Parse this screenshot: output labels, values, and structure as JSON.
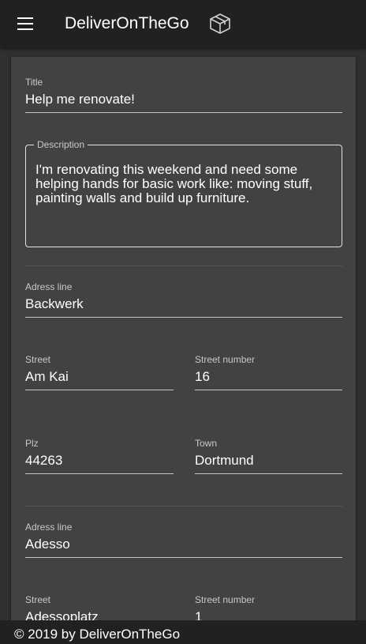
{
  "app": {
    "title": "DeliverOnTheGo",
    "menu_icon": "hamburger-menu-icon",
    "logo_icon": "package-box-icon"
  },
  "colors": {
    "toolbar": "#212121",
    "background": "#303030",
    "card": "#424242",
    "text": "#ffffff"
  },
  "form": {
    "title": {
      "label": "Title",
      "value": "Help me renovate!"
    },
    "description": {
      "label": "Description",
      "value": "I'm renovating this weekend and need some helping hands for basic work like: moving stuff, painting walls and build up furniture."
    },
    "addresses": [
      {
        "address_line": {
          "label": "Adress line",
          "value": "Backwerk"
        },
        "street": {
          "label": "Street",
          "value": "Am Kai"
        },
        "street_number": {
          "label": "Street number",
          "value": "16"
        },
        "plz": {
          "label": "Plz",
          "value": "44263"
        },
        "town": {
          "label": "Town",
          "value": "Dortmund"
        }
      },
      {
        "address_line": {
          "label": "Adress line",
          "value": "Adesso"
        },
        "street": {
          "label": "Street",
          "value": "Adessoplatz"
        },
        "street_number": {
          "label": "Street number",
          "value": "1"
        }
      }
    ]
  },
  "footer": {
    "text": "© 2019 by DeliverOnTheGo"
  }
}
